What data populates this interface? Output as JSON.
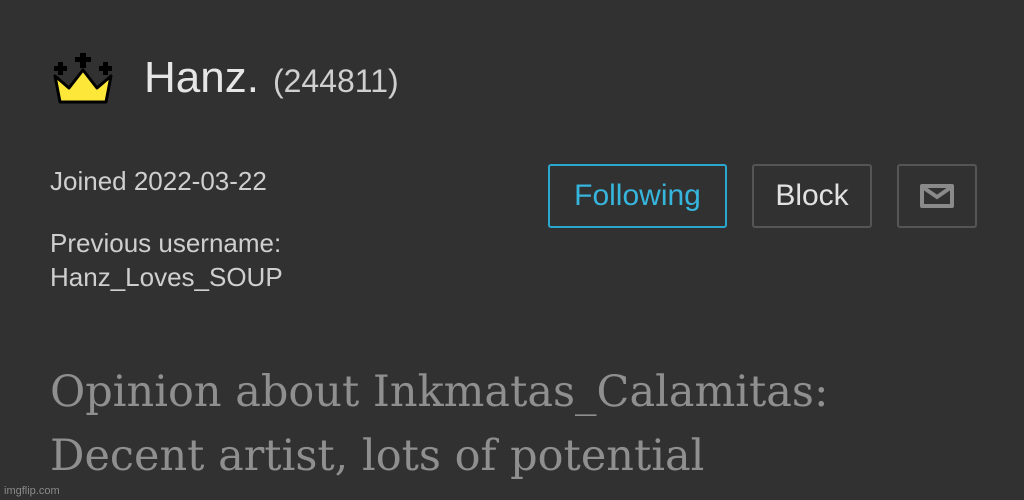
{
  "profile": {
    "username": "Hanz.",
    "user_id": "(244811)",
    "joined": "Joined 2022-03-22",
    "previous_username_label": "Previous username:",
    "previous_username": "Hanz_Loves_SOUP",
    "badge_icon": "crown-icon",
    "badge_color": "#fde83a"
  },
  "actions": {
    "following_label": "Following",
    "block_label": "Block",
    "message_icon": "envelope-icon",
    "accent": "#2aa7cf"
  },
  "opinion": {
    "line1": "Opinion about Inkmatas_Calamitas:",
    "line2": "Decent artist, lots of potential"
  },
  "watermark": "imgflip.com"
}
